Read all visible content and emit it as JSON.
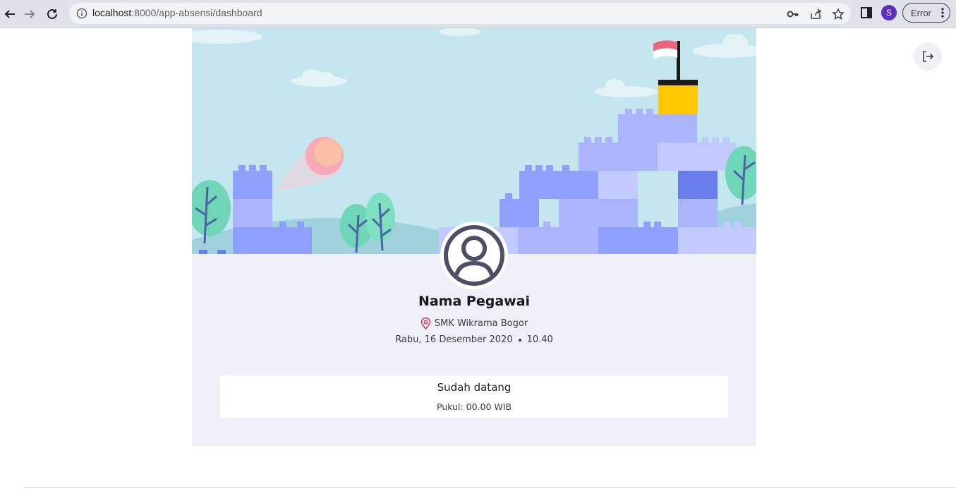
{
  "browser": {
    "url_host": "localhost",
    "url_path": ":8000/app-absensi/dashboard",
    "profile_initial": "S",
    "error_label": "Error",
    "icons": [
      "back-arrow-icon",
      "forward-arrow-icon",
      "reload-icon",
      "info-icon",
      "key-icon",
      "share-icon",
      "star-icon",
      "side-panel-icon",
      "kebab-menu-icon"
    ]
  },
  "profile": {
    "name": "Nama Pegawai",
    "location": "SMK Wikrama Bogor",
    "date": "Rabu, 16 Desember 2020",
    "time": "10.40"
  },
  "attendance": {
    "status": "Sudah datang",
    "time_label": "Pukul: 00.00 WIB"
  },
  "actions": {
    "logout_icon": "logout-icon"
  },
  "colors": {
    "accent_blue": "#8f9ffc",
    "sky": "#c4e6ee",
    "card_bg": "#efeff8",
    "flag_red": "#e8677d",
    "tower_yellow": "#ffc800",
    "avatar_stroke": "#4c4f66"
  }
}
